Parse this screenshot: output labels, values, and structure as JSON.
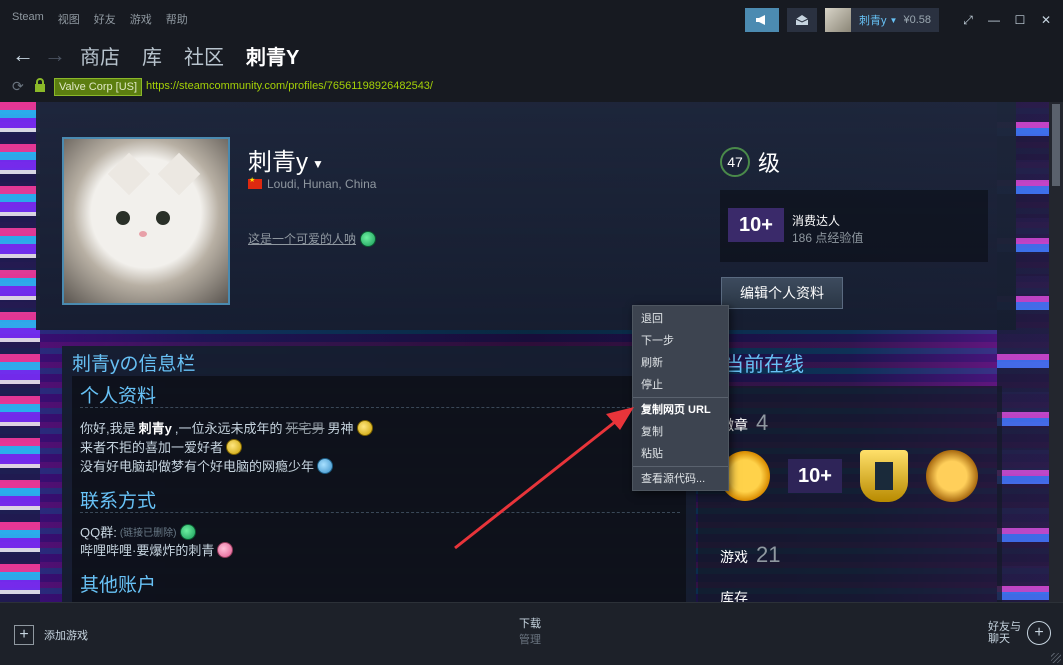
{
  "titlebar": {
    "app": "Steam",
    "menu": [
      "视图",
      "好友",
      "游戏",
      "帮助"
    ],
    "user_name": "刺青y",
    "balance": "¥0.58"
  },
  "nav": {
    "links": [
      "商店",
      "库",
      "社区",
      "刺青Y"
    ],
    "active_index": 3
  },
  "urlbar": {
    "cert_label": "Valve Corp [US]",
    "url": "https://steamcommunity.com/profiles/76561198926482543/"
  },
  "profile": {
    "name": "刺青y",
    "location": "Loudi, Hunan, China",
    "summary": "这是一个可爱的人呐",
    "level": "47",
    "level_label": "级",
    "badge_name": "消费达人",
    "badge_icon_text": "10+",
    "badge_xp": "186 点经验值",
    "edit_button": "编辑个人资料"
  },
  "info": {
    "panel_title": "刺青yの信息栏",
    "section1_title": "个人资料",
    "line1_a": "你好,我是",
    "line1_b": "刺青y",
    "line1_c": ",一位永远未成年的",
    "line1_strike": "死宅男",
    "line1_d": "男神",
    "line2": "来者不拒的喜加一爱好者",
    "line3": "没有好电脑却做梦有个好电脑的网瘾少年",
    "section2_title": "联系方式",
    "qq_label": "QQ群:",
    "qq_removed": "(链接已删除)",
    "bili": "哔哩哔哩·要爆炸的刺青",
    "section3_title": "其他账户"
  },
  "right": {
    "online_label": "当前在线",
    "badges_label": "徽章",
    "badges_count": "4",
    "badge2_text": "10+",
    "games_label": "游戏",
    "games_count": "21",
    "inventory_label": "库存"
  },
  "context_menu": {
    "items": [
      "退回",
      "下一步",
      "刷新",
      "停止",
      "复制网页 URL",
      "复制",
      "粘贴",
      "查看源代码..."
    ]
  },
  "bottombar": {
    "add_game": "添加游戏",
    "download": "下载",
    "manage": "管理",
    "friends_line1": "好友与",
    "friends_line2": "聊天"
  },
  "colors": {
    "accent_blue": "#67c1f5",
    "annotation_red": "#e8343a",
    "url_green": "#a4d007"
  }
}
